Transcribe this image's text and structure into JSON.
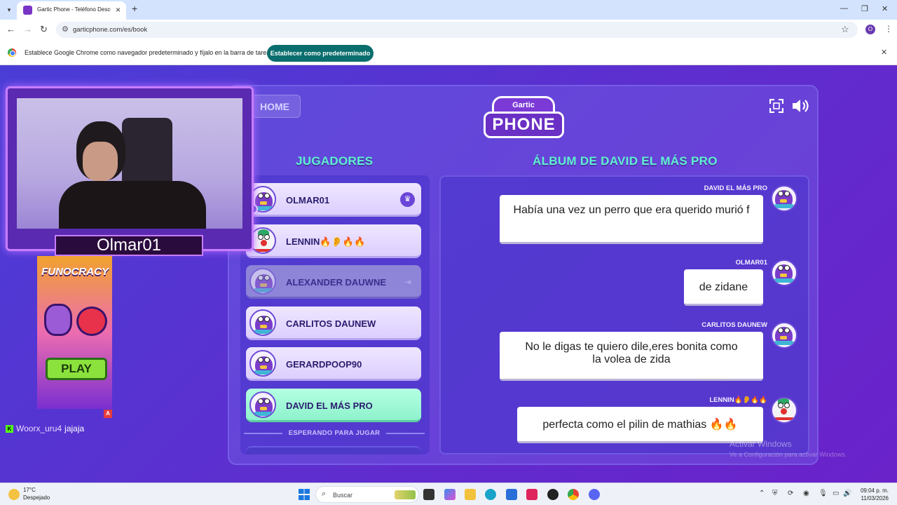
{
  "browser": {
    "tab_title": "Gartic Phone - Teléfono Descompuesto",
    "url": "garticphone.com/es/book",
    "profile_initial": "O",
    "infobar_text": "Establece Google Chrome como navegador predeterminado y fíjalo en la barra de tareas",
    "infobar_button": "Establecer como predeterminado"
  },
  "game": {
    "home_label": "HOME",
    "logo_top": "Gartic",
    "logo_main": "PHONE",
    "players_title": "JUGADORES",
    "album_title": "ÁLBUM DE DAVID EL MÁS PRO",
    "waiting_label": "ESPERANDO PARA JUGAR",
    "players": [
      {
        "name": "OLMAR01"
      },
      {
        "name": "LENNIN🔥👂🔥🔥"
      },
      {
        "name": "ALEXANDER DAUWNE"
      },
      {
        "name": "CARLITOS DAUNEW"
      },
      {
        "name": "GERARDPOOP90"
      },
      {
        "name": "DAVID EL MÁS PRO"
      }
    ],
    "messages": [
      {
        "author": "DAVID EL MÁS PRO",
        "text": "Había una vez un perro que era querido murió f"
      },
      {
        "author": "OLMAR01",
        "text": "de zidane"
      },
      {
        "author": "CARLITOS DAUNEW",
        "text": "No le digas te quiero dile,eres bonita como la volea de zida"
      },
      {
        "author": "LENNIN🔥👂🔥🔥",
        "text": "perfecta como el pilin de mathias 🔥🔥"
      }
    ],
    "watermark_title": "Activar Windows",
    "watermark_sub": "Ve a Configuración para activar Windows."
  },
  "stream": {
    "streamer_name": "Olmar01",
    "ad_logo": "FUNOCRACY",
    "ad_play": "PLAY",
    "ad_badge": "A",
    "chat": {
      "user": "Woorx_uru4",
      "message": "jajaja"
    }
  },
  "taskbar": {
    "temperature": "17°C",
    "weather": "Despejado",
    "search_placeholder": "Buscar",
    "time": "09:04 p. m.",
    "date": "11/03/2026"
  },
  "colors": {
    "accent_teal": "#5ef0d0",
    "game_purple": "#5d2fcf",
    "active_player": "#8ef2cc"
  }
}
